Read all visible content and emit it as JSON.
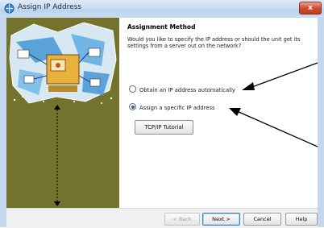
{
  "window": {
    "title": "Assign IP Address",
    "close_label": "x"
  },
  "main": {
    "heading": "Assignment Method",
    "question": "Would you like to specify the IP address or should the unit get its settings from a server out on the network?",
    "options": [
      {
        "label": "Obtain an IP address automatically",
        "selected": false
      },
      {
        "label": "Assign a specific IP address",
        "selected": true
      }
    ],
    "tutorial_label": "TCP/IP Tutorial"
  },
  "footer": {
    "back_label": "< Back",
    "next_label": "Next >",
    "cancel_label": "Cancel",
    "help_label": "Help"
  },
  "colors": {
    "side_panel": "#73732e",
    "selected_radio": "#2a5fb0",
    "close_button": "#cf4c30"
  }
}
